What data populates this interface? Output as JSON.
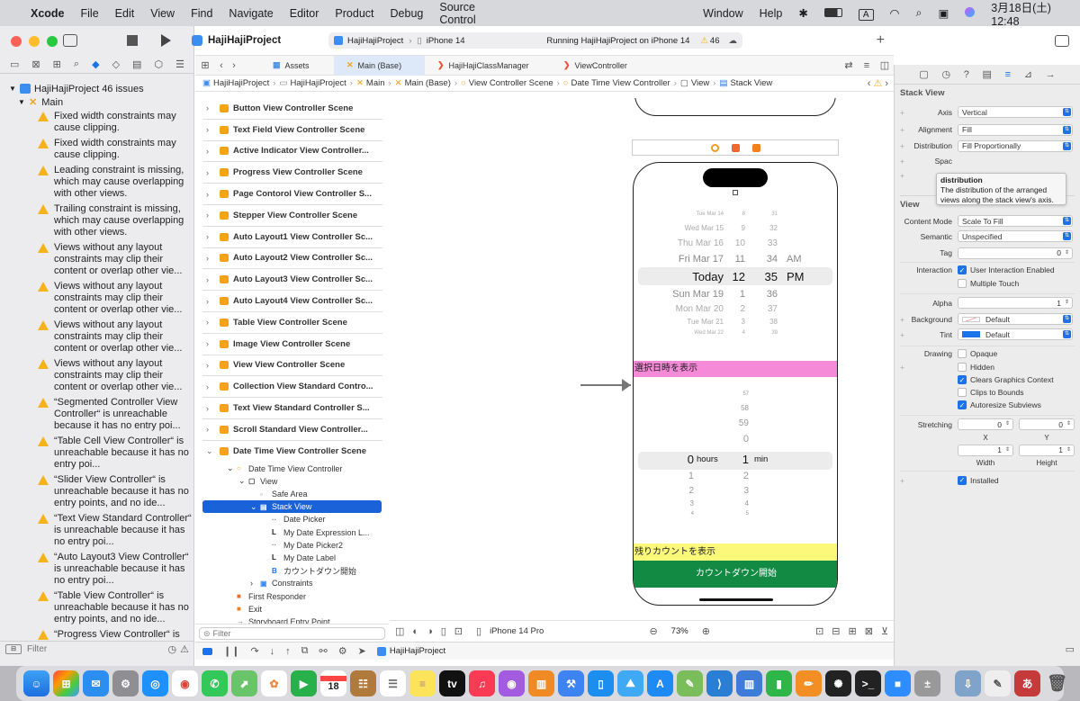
{
  "menubar": {
    "app_name": "Xcode",
    "items": [
      "File",
      "Edit",
      "View",
      "Find",
      "Navigate",
      "Editor",
      "Product",
      "Debug",
      "Source Control",
      "Window",
      "Help"
    ],
    "input_mode": "A",
    "datetime": "3月18日(土) 12:48"
  },
  "toolbar": {
    "project_name": "HajiHajiProject",
    "scheme": "HajiHajiProject",
    "device": "iPhone 14",
    "status": "Running HajiHajiProject on iPhone 14",
    "warning_count": "46"
  },
  "navigator": {
    "root_label": "HajiHajiProject 46 issues",
    "group_label": "Main",
    "issues": [
      "Fixed width constraints may cause clipping.",
      "Fixed width constraints may cause clipping.",
      "Leading constraint is missing, which may cause overlapping with other views.",
      "Trailing constraint is missing, which may cause overlapping with other views.",
      "Views without any layout constraints may clip their content or overlap other vie...",
      "Views without any layout constraints may clip their content or overlap other vie...",
      "Views without any layout constraints may clip their content or overlap other vie...",
      "Views without any layout constraints may clip their content or overlap other vie...",
      "“Segmented Controller View Controller“ is unreachable because it has no entry poi...",
      "“Table Cell View Controller“ is unreachable because it has no entry poi...",
      "“Slider View Controller“ is unreachable because it has no entry points, and no ide...",
      "“Text View Standard Controller“ is unreachable because it has no entry poi...",
      "“Auto Layout3 View Controller“ is unreachable because it has no entry poi...",
      "“Table View Controller“ is unreachable because it has no entry points, and no ide...",
      "“Progress View Controller“ is"
    ],
    "filter_placeholder": "Filter"
  },
  "editor_tabs": [
    {
      "label": "Assets",
      "active": false
    },
    {
      "label": "Main (Base)",
      "active": true
    },
    {
      "label": "HajiHajiClassManager",
      "active": false
    },
    {
      "label": "ViewController",
      "active": false
    }
  ],
  "breadcrumb": [
    "HajiHajiProject",
    "HajiHajiProject",
    "Main",
    "Main (Base)",
    "View Controller Scene",
    "Date Time View Controller",
    "View",
    "Stack View"
  ],
  "outline": {
    "scenes": [
      "Button View Controller Scene",
      "Text Field View Controller Scene",
      "Active Indicator View Controller...",
      "Progress View Controller Scene",
      "Page Contorol View Controller S...",
      "Stepper View Controller Scene",
      "Auto Layout1 View Controller Sc...",
      "Auto Layout2 View Controller Sc...",
      "Auto Layout3 View Controller Sc...",
      "Auto Layout4 View Controller Sc...",
      "Table View Controller Scene",
      "Image View Controller Scene",
      "View View Controller Scene",
      "Collection View Standard Contro...",
      "Text View Standard Controller S...",
      "Scroll Standard View Controller...",
      "Date Time View Controller Scene"
    ],
    "tree": [
      {
        "label": "Date Time View Controller",
        "indent": 1
      },
      {
        "label": "View",
        "indent": 2
      },
      {
        "label": "Safe Area",
        "indent": 3
      },
      {
        "label": "Stack View",
        "indent": 3
      },
      {
        "label": "Date Picker",
        "indent": 4
      },
      {
        "label": "My Date Expression L...",
        "indent": 4
      },
      {
        "label": "My Date Picker2",
        "indent": 4
      },
      {
        "label": "My Date Label",
        "indent": 4
      },
      {
        "label": "カウントダウン開始",
        "indent": 4
      },
      {
        "label": "Constraints",
        "indent": 3
      },
      {
        "label": "First Responder",
        "indent": 1
      },
      {
        "label": "Exit",
        "indent": 1
      },
      {
        "label": "Storyboard Entry Point",
        "indent": 1
      }
    ],
    "filter_placeholder": "Filter"
  },
  "canvas": {
    "date_wheel": [
      {
        "day": "Tue Mar 14",
        "hour": "8",
        "min": "31",
        "ap": ""
      },
      {
        "day": "Wed Mar 15",
        "hour": "9",
        "min": "32",
        "ap": ""
      },
      {
        "day": "Thu Mar 16",
        "hour": "10",
        "min": "33",
        "ap": ""
      },
      {
        "day": "Fri Mar 17",
        "hour": "11",
        "min": "34",
        "ap": "AM"
      },
      {
        "day": "Today",
        "hour": "12",
        "min": "35",
        "ap": "PM"
      },
      {
        "day": "Sun Mar 19",
        "hour": "1",
        "min": "36",
        "ap": ""
      },
      {
        "day": "Mon Mar 20",
        "hour": "2",
        "min": "37",
        "ap": ""
      },
      {
        "day": "Tue Mar 21",
        "hour": "3",
        "min": "38",
        "ap": ""
      },
      {
        "day": "Wed Mar 22",
        "hour": "4",
        "min": "39",
        "ap": ""
      }
    ],
    "label_selected_date": "選択日時を表示",
    "timer_hours": [
      "",
      "",
      "",
      "",
      "0",
      "1",
      "2",
      "3",
      "4"
    ],
    "timer_mins": [
      "57",
      "58",
      "59",
      "0",
      "1",
      "2",
      "3",
      "4",
      "5"
    ],
    "hours_unit": "hours",
    "min_unit": "min",
    "label_remaining": "残りカウントを表示",
    "button_countdown": "カウントダウン開始",
    "device_label": "iPhone 14 Pro",
    "zoom": "73%"
  },
  "inspector": {
    "stack_view_title": "Stack View",
    "axis_label": "Axis",
    "axis_value": "Vertical",
    "alignment_label": "Alignment",
    "alignment_value": "Fill",
    "distribution_label": "Distribution",
    "distribution_value": "Fill Proportionally",
    "spacing_label": "Spac",
    "tooltip_title": "distribution",
    "tooltip_text": "The distribution of the arranged views along the stack view's axis.",
    "view_title": "View",
    "content_mode_label": "Content Mode",
    "content_mode_value": "Scale To Fill",
    "semantic_label": "Semantic",
    "semantic_value": "Unspecified",
    "tag_label": "Tag",
    "tag_value": "0",
    "interaction_label": "Interaction",
    "user_interaction": "User Interaction Enabled",
    "multiple_touch": "Multiple Touch",
    "alpha_label": "Alpha",
    "alpha_value": "1",
    "background_label": "Background",
    "background_value": "Default",
    "tint_label": "Tint",
    "tint_value": "Default",
    "drawing_label": "Drawing",
    "opaque": "Opaque",
    "hidden": "Hidden",
    "clears_graphics": "Clears Graphics Context",
    "clips_bounds": "Clips to Bounds",
    "autoresize": "Autoresize Subviews",
    "stretching_label": "Stretching",
    "stretch_x": "0",
    "stretch_y": "0",
    "stretch_w": "1",
    "stretch_h": "1",
    "x_label": "X",
    "y_label": "Y",
    "width_label": "Width",
    "height_label": "Height",
    "installed": "Installed"
  },
  "debug_bar": {
    "target": "HajiHajiProject"
  },
  "dock": {
    "calendar_day": "18"
  },
  "colors": {
    "accent": "#1a73e8",
    "pink": "#f58bd8",
    "yellow": "#fbf87a",
    "green": "#128a44",
    "warning": "#f5b21a"
  }
}
